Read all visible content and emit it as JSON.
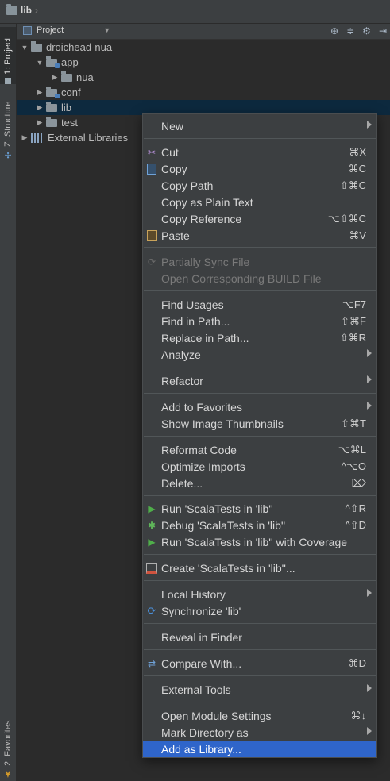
{
  "breadcrumb": {
    "item": "lib"
  },
  "tool_strip": {
    "project_tab": "1: Project",
    "structure_tab": "Z: Structure",
    "favorites_tab": "2: Favorites"
  },
  "project_header": {
    "view_label": "Project"
  },
  "tree": {
    "items": [
      {
        "label": "droichead-nua"
      },
      {
        "label": "app"
      },
      {
        "label": "nua"
      },
      {
        "label": "conf"
      },
      {
        "label": "lib"
      },
      {
        "label": "test"
      },
      {
        "label": "External Libraries"
      }
    ]
  },
  "menu": {
    "new": "New",
    "cut": "Cut",
    "cut_sc": "⌘X",
    "copy": "Copy",
    "copy_sc": "⌘C",
    "copy_path": "Copy Path",
    "copy_path_sc": "⇧⌘C",
    "copy_plain": "Copy as Plain Text",
    "copy_ref": "Copy Reference",
    "copy_ref_sc": "⌥⇧⌘C",
    "paste": "Paste",
    "paste_sc": "⌘V",
    "partial_sync": "Partially Sync File",
    "open_build": "Open Corresponding BUILD File",
    "find_usages": "Find Usages",
    "find_usages_sc": "⌥F7",
    "find_in_path": "Find in Path...",
    "find_in_path_sc": "⇧⌘F",
    "replace_in_path": "Replace in Path...",
    "replace_in_path_sc": "⇧⌘R",
    "analyze": "Analyze",
    "refactor": "Refactor",
    "add_favorites": "Add to Favorites",
    "show_thumbs": "Show Image Thumbnails",
    "show_thumbs_sc": "⇧⌘T",
    "reformat": "Reformat Code",
    "reformat_sc": "⌥⌘L",
    "optimize": "Optimize Imports",
    "optimize_sc": "^⌥O",
    "delete": "Delete...",
    "delete_sc": "⌦",
    "run": "Run 'ScalaTests in 'lib''",
    "run_sc": "^⇧R",
    "debug": "Debug 'ScalaTests in 'lib''",
    "debug_sc": "^⇧D",
    "run_cov": "Run 'ScalaTests in 'lib'' with Coverage",
    "create": "Create 'ScalaTests in 'lib''...",
    "local_history": "Local History",
    "synchronize": "Synchronize 'lib'",
    "reveal": "Reveal in Finder",
    "compare": "Compare With...",
    "compare_sc": "⌘D",
    "external_tools": "External Tools",
    "module_settings": "Open Module Settings",
    "module_settings_sc": "⌘↓",
    "mark_dir": "Mark Directory as",
    "add_library": "Add as Library..."
  }
}
